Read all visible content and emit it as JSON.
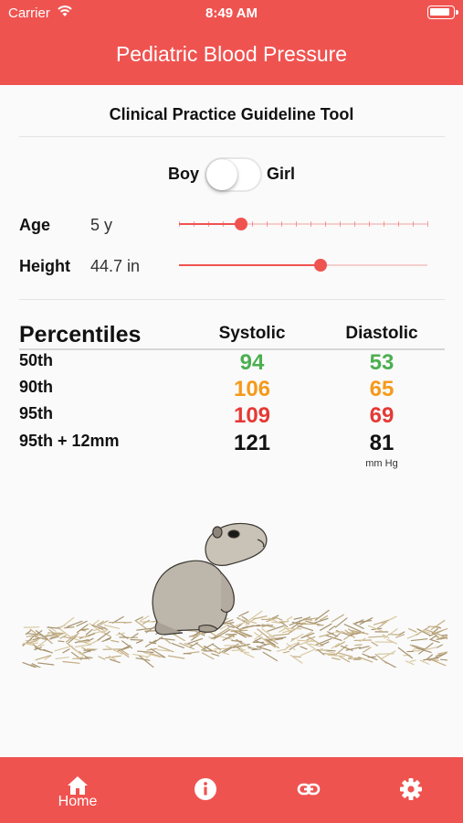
{
  "status_bar": {
    "carrier": "Carrier",
    "time": "8:49 AM",
    "wifi_icon": "wifi-icon",
    "battery_icon": "battery-icon"
  },
  "header": {
    "title": "Pediatric Blood Pressure"
  },
  "subtitle": "Clinical Practice Guideline Tool",
  "sex_toggle": {
    "left_label": "Boy",
    "right_label": "Girl",
    "selected": "Boy"
  },
  "inputs": {
    "age": {
      "label": "Age",
      "value": "5 y",
      "fraction": 0.25,
      "tick_count": 18
    },
    "height": {
      "label": "Height",
      "value": "44.7 in",
      "fraction": 0.57
    }
  },
  "table": {
    "header": {
      "percentiles": "Percentiles",
      "systolic": "Systolic",
      "diastolic": "Diastolic"
    },
    "rows": [
      {
        "label": "50th",
        "systolic": "94",
        "diastolic": "53",
        "color": "#4caf50"
      },
      {
        "label": "90th",
        "systolic": "106",
        "diastolic": "65",
        "color": "#f59a1b"
      },
      {
        "label": "95th",
        "systolic": "109",
        "diastolic": "69",
        "color": "#e53935"
      },
      {
        "label": "95th + 12mm",
        "systolic": "121",
        "diastolic": "81",
        "color": "#111111"
      }
    ],
    "unit": "mm Hg"
  },
  "illustration": {
    "subject": "prairie-dog-illustration"
  },
  "tabbar": {
    "items": [
      {
        "icon": "home-icon",
        "label": "Home"
      },
      {
        "icon": "info-icon",
        "label": ""
      },
      {
        "icon": "link-icon",
        "label": ""
      },
      {
        "icon": "gear-icon",
        "label": ""
      }
    ]
  },
  "colors": {
    "accent": "#ef5350",
    "accent_light": "#f6cfcf"
  }
}
